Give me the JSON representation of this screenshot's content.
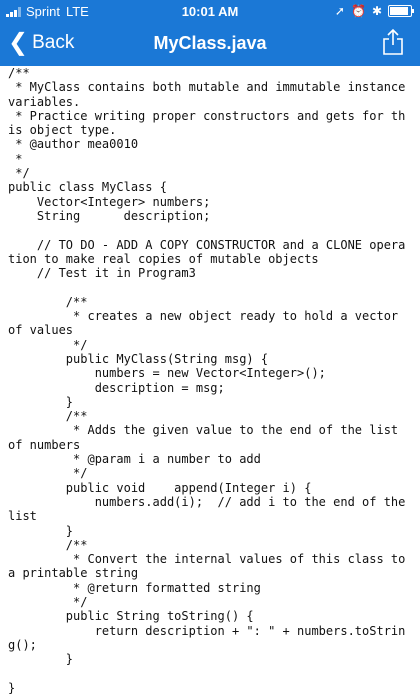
{
  "status_bar": {
    "carrier": "Sprint",
    "network": "LTE",
    "time": "10:01 AM"
  },
  "nav": {
    "back_label": "Back",
    "title": "MyClass.java",
    "back_icon": "chevron-left-icon",
    "share_icon": "share-icon"
  },
  "colors": {
    "bar_blue": "#1b78d6"
  },
  "code": "/**\n * MyClass contains both mutable and immutable instance variables.\n * Practice writing proper constructors and gets for this object type.\n * @author mea0010\n *\n */\npublic class MyClass {\n    Vector<Integer> numbers;\n    String      description;\n\n    // TO DO - ADD A COPY CONSTRUCTOR and a CLONE operation to make real copies of mutable objects\n    // Test it in Program3\n\n        /**\n         * creates a new object ready to hold a vector of values\n         */\n        public MyClass(String msg) {\n            numbers = new Vector<Integer>();\n            description = msg;\n        }\n        /**\n         * Adds the given value to the end of the list of numbers\n         * @param i a number to add\n         */\n        public void    append(Integer i) {\n            numbers.add(i);  // add i to the end of the list\n        }\n        /**\n         * Convert the internal values of this class to a printable string\n         * @return formatted string\n         */\n        public String toString() {\n            return description + \": \" + numbers.toString();\n        }\n\n}"
}
